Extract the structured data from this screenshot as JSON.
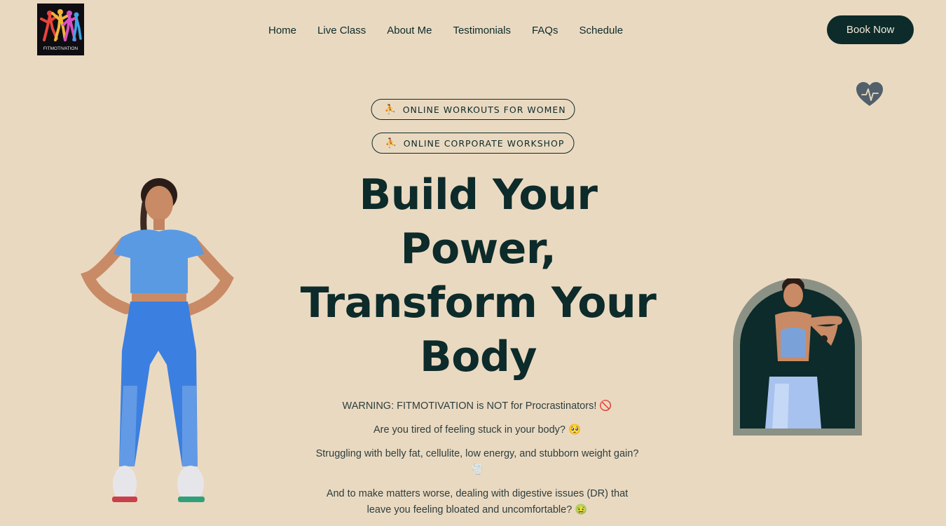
{
  "brand": {
    "logo_text": "FITMOTIVATION"
  },
  "nav": {
    "items": [
      "Home",
      "Live Class",
      "About Me",
      "Testimonials",
      "FAQs",
      "Schedule"
    ]
  },
  "cta": {
    "book_label": "Book Now"
  },
  "badges": [
    {
      "icon": "yoga-icon",
      "label": "ONLINE WORKOUTS FOR WOMEN"
    },
    {
      "icon": "meditation-icon",
      "label": "ONLINE CORPORATE WORKSHOP"
    }
  ],
  "hero": {
    "headline_lines": [
      "Build Your",
      "Power,",
      "Transform Your",
      "Body"
    ],
    "paragraphs": [
      "WARNING: FITMOTIVATION is NOT for Procrastinators! 🚫",
      "Are you tired of feeling stuck in your body? 🥺",
      "Struggling with belly fat, cellulite, low energy, and stubborn weight gain? 🌪️",
      "And to make matters worse, dealing with digestive issues (DR) that leave you feeling bloated and uncomfortable? 🤢"
    ]
  },
  "colors": {
    "background": "#ead9c1",
    "primary": "#0c2b2a",
    "accent_blue": "#4f8ee6",
    "arch_border": "#8b9285"
  },
  "icons": {
    "heart": "heart-pulse-icon"
  }
}
